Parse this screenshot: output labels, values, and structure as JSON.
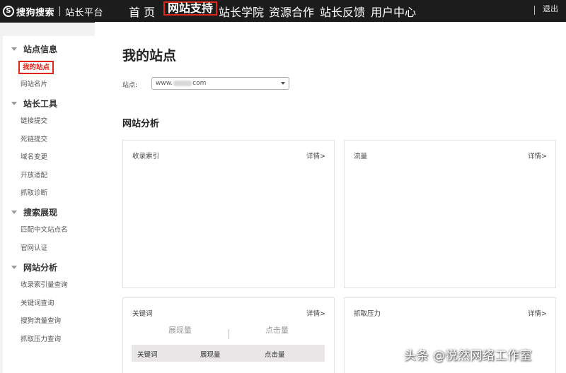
{
  "header": {
    "logo_mark": "S",
    "brand": "搜狗搜索",
    "platform": "站长平台",
    "nav": [
      "首 页",
      "网站支持",
      "站长学院",
      "资源合作",
      "站长反馈",
      "用户中心"
    ],
    "active_nav": "网站支持",
    "logout": "退出"
  },
  "sidebar": {
    "sections": [
      {
        "title": "站点信息",
        "items": [
          "我的站点",
          "网站名片"
        ]
      },
      {
        "title": "站长工具",
        "items": [
          "链接提交",
          "死链提交",
          "域名变更",
          "开放适配",
          "抓取诊断"
        ]
      },
      {
        "title": "搜索展现",
        "items": [
          "匹配中文站点名",
          "官网认证"
        ]
      },
      {
        "title": "网站分析",
        "items": [
          "收录索引量查询",
          "关键词查询",
          "搜狗流量查询",
          "抓取压力查询"
        ]
      }
    ],
    "active_item": "我的站点"
  },
  "main": {
    "page_title": "我的站点",
    "site_label": "站点:",
    "site_value_prefix": "www.",
    "site_value_suffix": "com",
    "section_title": "网站分析",
    "cards": [
      {
        "title": "收录索引",
        "link": "详情>"
      },
      {
        "title": "流量",
        "link": "详情>"
      },
      {
        "title": "关键词",
        "link": "详情>"
      },
      {
        "title": "抓取压力",
        "link": "详情>"
      }
    ],
    "keyword_metrics": [
      "展现量",
      "点击量"
    ],
    "keyword_table_headers": [
      "关键词",
      "展现量",
      "点击量"
    ]
  },
  "watermark": "头条 @悦然网络工作室",
  "colors": {
    "topbar": "#1c1c1c",
    "highlight": "#e1251b",
    "background": "#f2f2f2"
  }
}
